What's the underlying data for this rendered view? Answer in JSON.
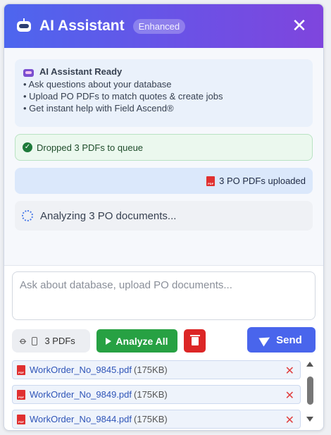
{
  "header": {
    "title": "AI Assistant",
    "badge": "Enhanced",
    "close_label": "✕"
  },
  "messages": {
    "ready": {
      "title": "AI Assistant Ready",
      "lines": [
        "• Ask questions about your database",
        "• Upload PO PDFs to match quotes & create jobs",
        "• Get instant help with Field Ascend®"
      ]
    },
    "dropped": "Dropped 3 PDFs to queue",
    "uploaded": "3 PO PDFs uploaded",
    "analyzing": "Analyzing 3 PO documents..."
  },
  "input": {
    "placeholder": "Ask about database, upload PO documents..."
  },
  "toolbar": {
    "pdf_count": "3 PDFs",
    "analyze_label": "Analyze All",
    "send_label": "Send"
  },
  "files": [
    {
      "name": "WorkOrder_No_9845.pdf",
      "size": "(175KB)"
    },
    {
      "name": "WorkOrder_No_9849.pdf",
      "size": "(175KB)"
    },
    {
      "name": "WorkOrder_No_9844.pdf",
      "size": "(175KB)"
    }
  ],
  "colors": {
    "header_start": "#4d66ee",
    "header_end": "#7f45dd",
    "analyze": "#27a143",
    "delete": "#dc2626",
    "send": "#4965ec"
  }
}
